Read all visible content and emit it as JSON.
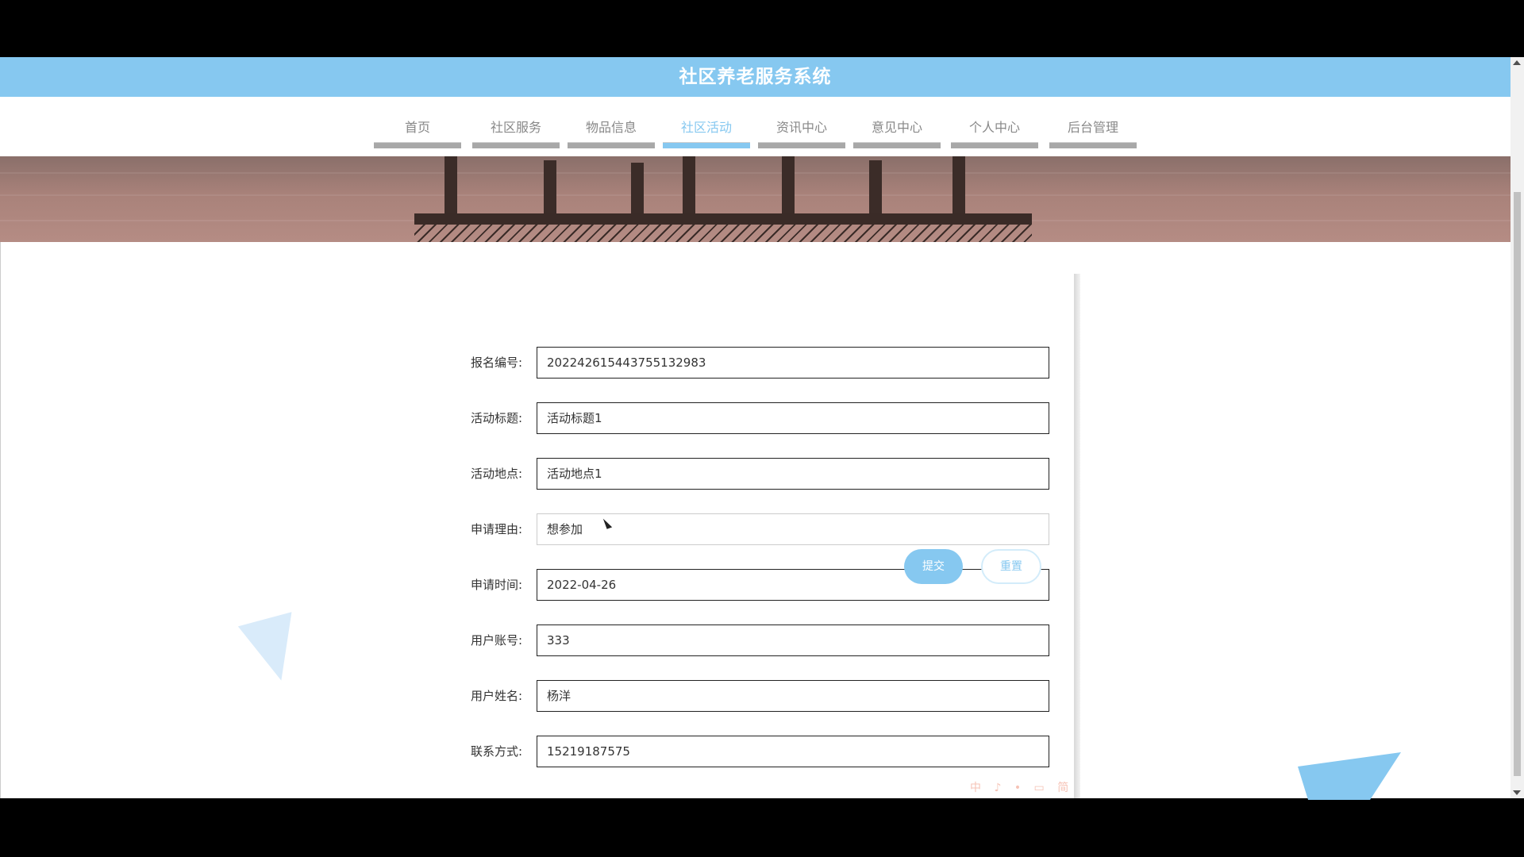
{
  "header": {
    "title": "社区养老服务系统"
  },
  "nav": {
    "items": [
      {
        "label": "首页"
      },
      {
        "label": "社区服务"
      },
      {
        "label": "物品信息"
      },
      {
        "label": "社区活动",
        "active": true
      },
      {
        "label": "资讯中心"
      },
      {
        "label": "意见中心"
      },
      {
        "label": "个人中心"
      },
      {
        "label": "后台管理"
      }
    ]
  },
  "form": {
    "fields": [
      {
        "label": "报名编号:",
        "value": "202242615443755132983"
      },
      {
        "label": "活动标题:",
        "value": "活动标题1"
      },
      {
        "label": "活动地点:",
        "value": "活动地点1"
      },
      {
        "label": "申请理由:",
        "value": "想参加"
      },
      {
        "label": "申请时间:",
        "value": "2022-04-26"
      },
      {
        "label": "用户账号:",
        "value": "333"
      },
      {
        "label": "用户姓名:",
        "value": "杨洋"
      },
      {
        "label": "联系方式:",
        "value": "15219187575"
      }
    ],
    "submit_label": "提交",
    "reset_label": "重置"
  },
  "ime_indicator": "中 ♪ • ▭ 简",
  "colors": {
    "accent": "#86c8f0",
    "nav_inactive_bar": "#a8a8a8",
    "text": "#333333"
  }
}
